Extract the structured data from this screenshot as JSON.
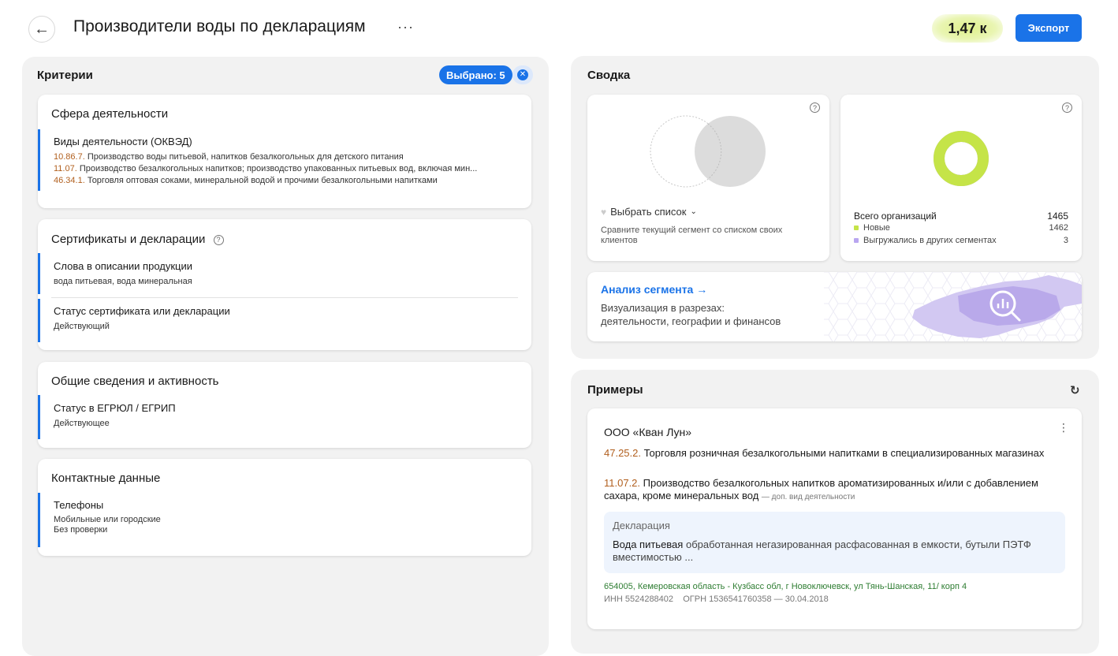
{
  "header": {
    "title": "Производители воды по декларациям",
    "more_label": "···",
    "count": "1,47 к",
    "export_label": "Экспорт",
    "colors": {
      "accent": "#1a73e8",
      "count_highlight": "#dff08a"
    }
  },
  "criteria": {
    "title": "Критерии",
    "selected_label": "Выбрано: 5",
    "clear_glyph": "✕",
    "sections": [
      {
        "title": "Сфера деятельности",
        "items": [
          {
            "name": "Виды деятельности (ОКВЭД)",
            "codes": [
              {
                "code": "10.86.7.",
                "text": "Производство воды питьевой, напитков безалкогольных для детского питания"
              },
              {
                "code": "11.07.",
                "text": "Производство безалкогольных напитков; производство упакованных питьевых вод, включая мин..."
              },
              {
                "code": "46.34.1.",
                "text": "Торговля оптовая соками, минеральной водой и прочими безалкогольными напитками"
              }
            ]
          }
        ]
      },
      {
        "title": "Сертификаты и декларации",
        "help": "?",
        "items": [
          {
            "name": "Слова в описании продукции",
            "value": "вода питьевая, вода минеральная"
          },
          {
            "name": "Статус сертификата или декларации",
            "value": "Действующий"
          }
        ]
      },
      {
        "title": "Общие сведения и активность",
        "items": [
          {
            "name": "Статус в ЕГРЮЛ / ЕГРИП",
            "value": "Действующее"
          }
        ]
      },
      {
        "title": "Контактные данные",
        "items": [
          {
            "name": "Телефоны",
            "value1": "Мобильные или городские",
            "value2": "Без проверки"
          }
        ]
      }
    ]
  },
  "summary": {
    "title": "Сводка",
    "help": "?",
    "venn": {
      "choose_label": "Выбрать список",
      "description": "Сравните текущий сегмент со списком своих клиентов"
    },
    "donut": {
      "new_fraction": 0.998,
      "total_label": "Всего организаций",
      "total_value": "1465",
      "new_label": "Новые",
      "new_value": "1462",
      "exported_label": "Выгружались в других сегментах",
      "exported_value": "3",
      "colors": {
        "new": "#c5e448",
        "exported": "#b9a6f0"
      }
    },
    "analysis": {
      "title": "Анализ сегмента →",
      "desc1": "Визуализация в разрезах:",
      "desc2": "деятельности, географии и финансов"
    }
  },
  "examples": {
    "title": "Примеры",
    "refresh": "↻",
    "org": {
      "name": "ООО «Кван Лун»",
      "kebab": "⋮",
      "activities": [
        {
          "code": "47.25.2.",
          "text": "Торговля розничная безалкогольными напитками в специализированных магазинах",
          "aux": ""
        },
        {
          "code": "11.07.2.",
          "text": "Производство безалкогольных напитков ароматизированных и/или с добавлением сахара, кроме минеральных вод",
          "aux": "— доп. вид деятельности"
        }
      ],
      "declaration": {
        "label": "Декларация",
        "bold": "Вода питьевая",
        "text": "обработанная негазированная расфасованная в емкости, бутыли ПЭТФ вместимостью ..."
      },
      "address": "654005, Кемеровская область - Кузбасс обл, г Новоключевск, ул Тянь-Шанская, 11/ корп 4",
      "ids": "ИНН 5524288402    ОГРН 1536541760358 — 30.04.2018"
    }
  }
}
